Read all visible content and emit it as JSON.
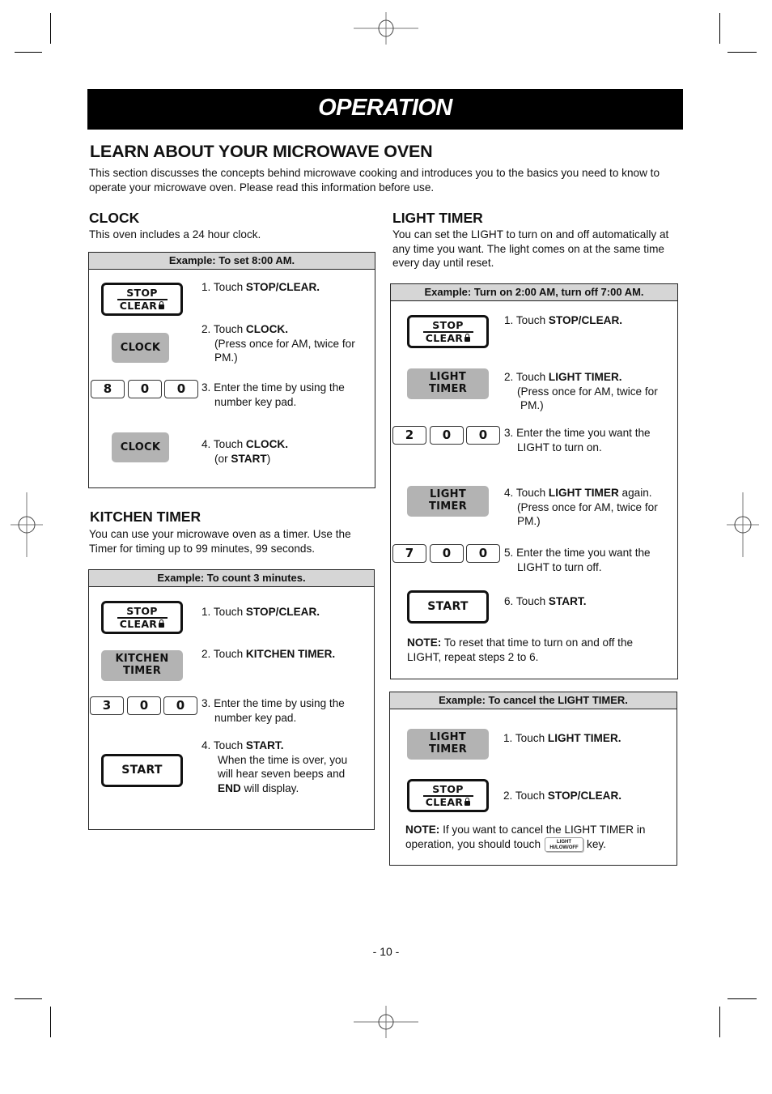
{
  "banner": {
    "title": "OPERATION"
  },
  "intro": {
    "heading": "LEARN ABOUT YOUR MICROWAVE OVEN",
    "text": "This section discusses the concepts behind microwave cooking and introduces you to the basics you need to know to operate your microwave oven. Please read this information before use."
  },
  "clock": {
    "heading": "CLOCK",
    "text": "This oven includes a 24 hour clock.",
    "example": "Example: To set 8:00 AM.",
    "digits": [
      "8",
      "0",
      "0"
    ],
    "steps": [
      {
        "num": "1. Touch ",
        "bold": "STOP/CLEAR.",
        "rest": ""
      },
      {
        "num": "2. Touch ",
        "bold": "CLOCK.",
        "rest": "(Press once for AM, twice for PM.)"
      },
      {
        "num": "3. Enter the time by using the",
        "bold": "",
        "rest": "number key pad."
      },
      {
        "num": "4. Touch ",
        "bold": "CLOCK.",
        "rest_pre": "(or ",
        "rest_bold": "START",
        "rest_post": ")"
      }
    ]
  },
  "kitchen_timer": {
    "heading": "KITCHEN TIMER",
    "text": "You can use your microwave oven as a timer. Use the Timer for timing up to 99 minutes, 99 seconds.",
    "example": "Example: To count 3 minutes.",
    "digits": [
      "3",
      "0",
      "0"
    ],
    "steps": [
      {
        "num": "1. Touch ",
        "bold": "STOP/CLEAR."
      },
      {
        "num": "2. Touch ",
        "bold": "KITCHEN TIMER."
      },
      {
        "num": "3. Enter the time by using the",
        "rest": "number key pad."
      },
      {
        "num": "4. Touch ",
        "bold": "START.",
        "rest1": "When the time is over, you",
        "rest2": "will hear seven beeps and",
        "rest3_bold": "END",
        "rest3": " will display."
      }
    ]
  },
  "light_timer": {
    "heading": "LIGHT TIMER",
    "text": "You can set the LIGHT to turn on and off automatically at any time you want. The light comes on at the same time every day until reset.",
    "example": "Example: Turn on 2:00 AM, turn off 7:00 AM.",
    "digits_on": [
      "2",
      "0",
      "0"
    ],
    "digits_off": [
      "7",
      "0",
      "0"
    ],
    "steps": [
      {
        "num": "1. Touch ",
        "bold": "STOP/CLEAR."
      },
      {
        "num": "2. Touch ",
        "bold": "LIGHT TIMER.",
        "rest": "(Press once for AM, twice for",
        "rest2": "PM.)"
      },
      {
        "num": "3. Enter the time you want the",
        "rest": "LIGHT to turn on."
      },
      {
        "num": "4. Touch ",
        "bold": "LIGHT TIMER",
        "after": " again.",
        "rest": "(Press once for AM, twice for",
        "rest2": "PM.)"
      },
      {
        "num": "5. Enter the time you want the",
        "rest": "LIGHT to turn off."
      },
      {
        "num": "6. Touch ",
        "bold": "START."
      }
    ],
    "note_label": "NOTE:",
    "note": " To reset that time to turn on and off the LIGHT, repeat steps 2 to 6."
  },
  "cancel_light": {
    "example": "Example: To cancel the LIGHT TIMER.",
    "steps": [
      {
        "num": "1. Touch ",
        "bold": "LIGHT TIMER."
      },
      {
        "num": "2. Touch ",
        "bold": "STOP/CLEAR."
      }
    ],
    "note_label": "NOTE:",
    "note_pre": " If you want to cancel the LIGHT TIMER in operation, you should touch",
    "note_post": "key.",
    "mini_key_line1": "LIGHT",
    "mini_key_line2": "HI/LOW/OFF"
  },
  "keys": {
    "stop": "STOP",
    "clear": "CLEAR",
    "clock": "CLOCK",
    "kitchen1": "KITCHEN",
    "kitchen2": "TIMER",
    "light1": "LIGHT",
    "light2": "TIMER",
    "start": "START"
  },
  "footer": {
    "page_number": "- 10 -"
  }
}
